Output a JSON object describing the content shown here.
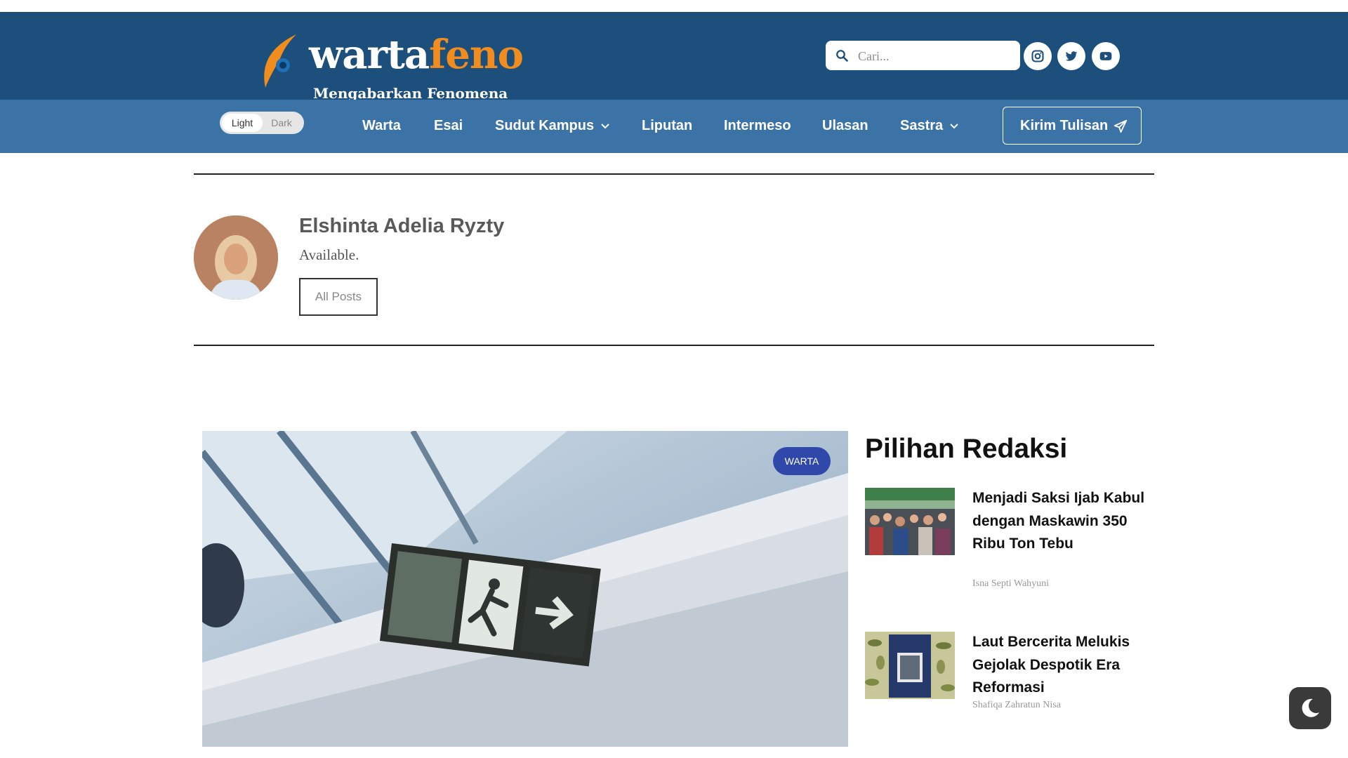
{
  "brand": {
    "name_part1": "warta",
    "name_part2": "feno",
    "tagline": "Mengabarkan Fenomena",
    "colors": {
      "header": "#1c4f7c",
      "nav": "#3c73a6",
      "accent": "#f18c1f",
      "badge": "#2f48a9"
    }
  },
  "search": {
    "placeholder": "Cari..."
  },
  "social": [
    "instagram-icon",
    "twitter-icon",
    "youtube-icon"
  ],
  "theme_toggle": {
    "light": "Light",
    "dark": "Dark",
    "selected": "Light"
  },
  "nav": {
    "items": [
      {
        "label": "Warta",
        "dropdown": false
      },
      {
        "label": "Esai",
        "dropdown": false
      },
      {
        "label": "Sudut Kampus",
        "dropdown": true
      },
      {
        "label": "Liputan",
        "dropdown": false
      },
      {
        "label": "Intermeso",
        "dropdown": false
      },
      {
        "label": "Ulasan",
        "dropdown": false
      },
      {
        "label": "Sastra",
        "dropdown": true
      }
    ],
    "cta": "Kirim Tulisan"
  },
  "author": {
    "name": "Elshinta Adelia Ryzty",
    "bio": "Available.",
    "button": "All Posts"
  },
  "featured": {
    "category": "WARTA"
  },
  "pilihan": {
    "title": "Pilihan Redaksi",
    "items": [
      {
        "title": "Menjadi Saksi Ijab Kabul dengan Maskawin 350 Ribu Ton Tebu",
        "author": "Isna Septi Wahyuni"
      },
      {
        "title": "Laut Bercerita Melukis Gejolak Despotik Era Reformasi",
        "author": "Shafiqa Zahratun Nisa"
      }
    ]
  }
}
